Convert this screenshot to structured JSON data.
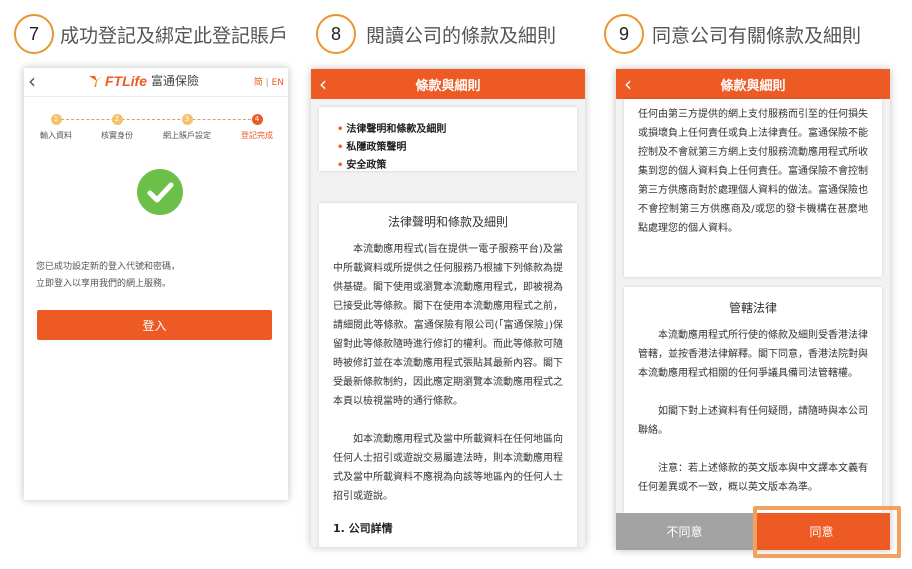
{
  "steps": [
    {
      "number": "7",
      "title": "成功登記及綁定此登記賬戶"
    },
    {
      "number": "8",
      "title": "閱讀公司的條款及細則"
    },
    {
      "number": "9",
      "title": "同意公司有關條款及細則"
    }
  ],
  "screen1": {
    "back_icon": "back-arrow-icon",
    "brand": "FTLife",
    "brand_chinese": "富通保險",
    "lang_simplified": "简",
    "lang_divider": "|",
    "lang_english": "EN",
    "progress": [
      {
        "num": "1",
        "label": "輸入資料"
      },
      {
        "num": "2",
        "label": "核實身份"
      },
      {
        "num": "3",
        "label": "網上賬戶設定"
      },
      {
        "num": "4",
        "label": "登記完成"
      }
    ],
    "current_step": 4,
    "success_icon": "check-circle-icon",
    "message_line1": "您已成功設定新的登入代號和密碼，",
    "message_line2": "立即登入以享用我們的網上服務。",
    "login_button": "登入",
    "accent_color": "#ee5a24",
    "success_color": "#6cc04a"
  },
  "screen2": {
    "header_title": "條款與細則",
    "links": [
      "法律聲明和條款及細則",
      "私隱政策聲明",
      "安全政策"
    ],
    "section_title": "法律聲明和條款及細則",
    "para1": "本流動應用程式(旨在提供一電子服務平台)及當中所載資料或所提供之任何服務乃根據下列條款為提供基礎。閣下使用或瀏覽本流動應用程式，即被視為已接受此等條款。閣下在使用本流動應用程式之前，請細閱此等條款。富通保險有限公司(「富通保險」)保留對此等條款隨時進行修訂的權利。而此等條款可隨時被修訂並在本流動應用程式張貼其最新內容。閣下受最新條款制約，因此應定期瀏覽本流動應用程式之本頁以檢視當時的通行條款。",
    "para2": "如本流動應用程式及當中所載資料在任何地區向任何人士招引或遊說交易屬違法時，則本流動應用程式及當中所載資料不應視為向該等地區內的任何人士招引或遊說。",
    "subheading": "1. 公司詳情"
  },
  "screen3": {
    "header_title": "條款與細則",
    "top_para": "任何由第三方提供的網上支付服務而引至的任何損失或損壞負上任何責任或負上法律責任。富通保險不能控制及不會就第三方網上支付服務流動應用程式所收集到您的個人資料負上任何責任。富通保險不會控制第三方供應商對於處理個人資料的做法。富通保險也不會控制第三方供應商及/或您的發卡機構在甚麼地點處理您的個人資料。",
    "section_title": "管轄法律",
    "law_para": "本流動應用程式所行使的條款及細則受香港法律管轄，並按香港法律解釋。閣下同意，香港法院對與本流動應用程式相關的任何爭議具備司法管轄權。",
    "contact_para": "如閣下對上述資料有任何疑問，請隨時與本公司聯絡。",
    "note_para": "注意：若上述條款的英文版本與中文譯本文義有任何差異或不一致，概以英文版本為準。",
    "disagree_button": "不同意",
    "agree_button": "同意",
    "highlight_color": "#f2a15f"
  }
}
